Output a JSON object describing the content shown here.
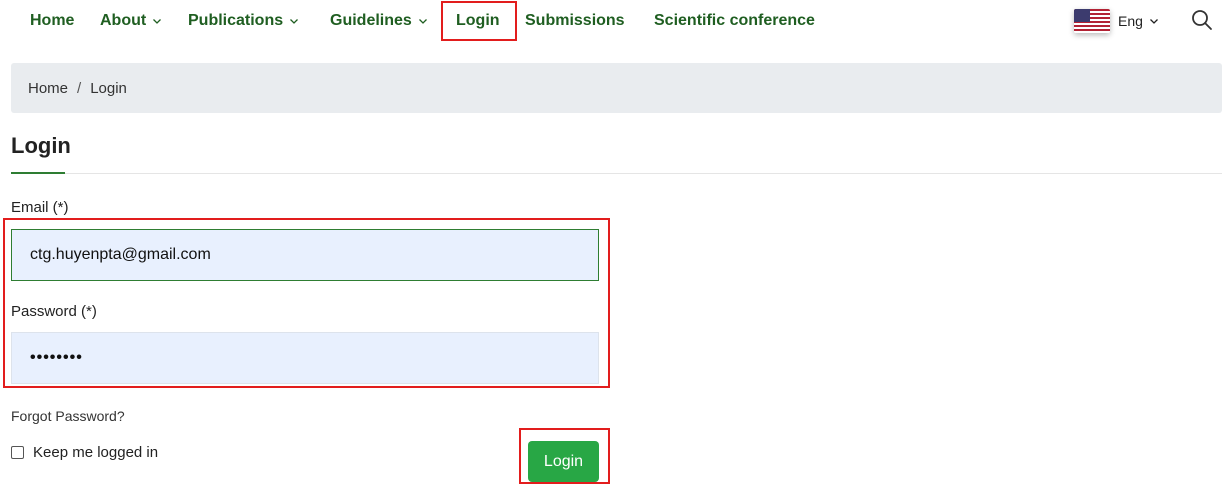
{
  "nav": {
    "items": [
      {
        "label": "Home",
        "has_dropdown": false
      },
      {
        "label": "About",
        "has_dropdown": true
      },
      {
        "label": "Publications",
        "has_dropdown": true
      },
      {
        "label": "Guidelines",
        "has_dropdown": true
      },
      {
        "label": "Login",
        "has_dropdown": false
      },
      {
        "label": "Submissions",
        "has_dropdown": false
      },
      {
        "label": "Scientific conference",
        "has_dropdown": false
      }
    ],
    "language": "Eng",
    "flag_icon": "us-flag-icon",
    "search_icon": "search-icon"
  },
  "breadcrumb": {
    "home": "Home",
    "separator": "/",
    "current": "Login"
  },
  "page_title": "Login",
  "form": {
    "email_label": "Email (*)",
    "email_value": "ctg.huyenpta@gmail.com",
    "password_label": "Password (*)",
    "password_value": "••••••••",
    "forgot_password": "Forgot Password?",
    "keep_logged_in": "Keep me logged in",
    "keep_logged_in_checked": false,
    "submit_label": "Login"
  },
  "colors": {
    "nav_text": "#1f5e21",
    "highlight_box": "#e21d1d",
    "button": "#28a745",
    "field_bg": "#e8f0fe",
    "breadcrumb_bg": "#e9ecef"
  }
}
